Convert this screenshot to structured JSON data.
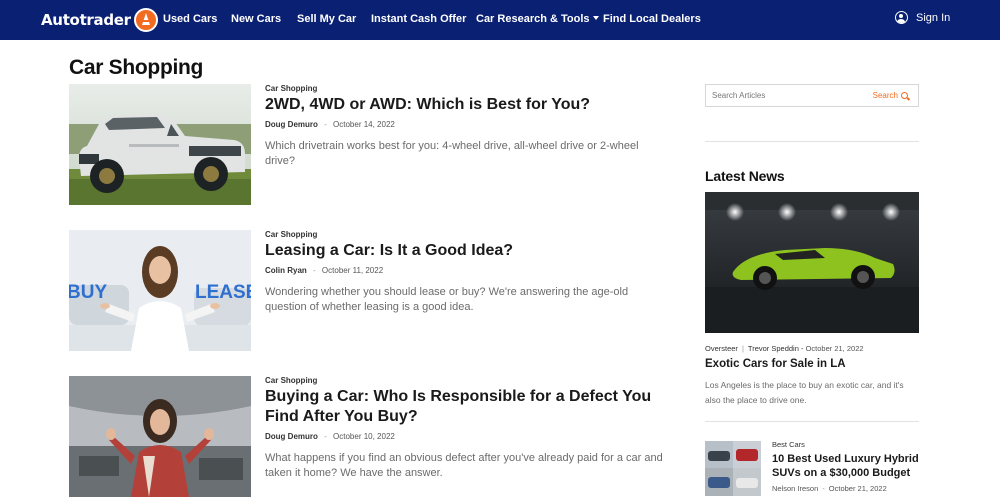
{
  "nav": {
    "logo_text": "Autotrader",
    "items": [
      "Used Cars",
      "New Cars",
      "Sell My Car",
      "Instant Cash Offer",
      "Car Research & Tools",
      "Find Local Dealers"
    ],
    "signin": "Sign In"
  },
  "page_title": "Car Shopping",
  "articles": [
    {
      "category": "Car Shopping",
      "title": "2WD, 4WD or AWD: Which is Best for You?",
      "author": "Doug Demuro",
      "separator": "-",
      "date": "October 14, 2022",
      "description": "Which drivetrain works best for you: 4-wheel drive, all-wheel drive or 2-wheel drive?"
    },
    {
      "category": "Car Shopping",
      "title": "Leasing a Car: Is It a Good Idea?",
      "author": "Colin Ryan",
      "separator": "-",
      "date": "October 11, 2022",
      "description": "Wondering whether you should lease or buy? We're answering the age-old question of whether leasing is a good idea.",
      "image_text_left": "BUY",
      "image_text_right": "LEASE"
    },
    {
      "category": "Car Shopping",
      "title": "Buying a Car: Who Is Responsible for a Defect You Find After You Buy?",
      "author": "Doug Demuro",
      "separator": "-",
      "date": "October 10, 2022",
      "description": "What happens if you find an obvious defect after you've already paid for a car and taken it home? We have the answer."
    }
  ],
  "sidebar": {
    "search_placeholder": "Search Articles",
    "search_button": "Search",
    "latest_title": "Latest News",
    "featured": {
      "category": "Oversteer",
      "separator": "|",
      "author": "Trevor Speddin",
      "dash": "-",
      "date": "October 21, 2022",
      "title": "Exotic Cars for Sale in LA",
      "description": "Los Angeles is the place to buy an exotic car, and it's also the place to drive one."
    },
    "small": {
      "category": "Best Cars",
      "title": "10 Best Used Luxury Hybrid SUVs on a $30,000 Budget",
      "author": "Nelson Ireson",
      "dash": "-",
      "date": "October 21, 2022"
    }
  },
  "colors": {
    "nav_bg": "#0a2073",
    "accent": "#f26b21"
  }
}
